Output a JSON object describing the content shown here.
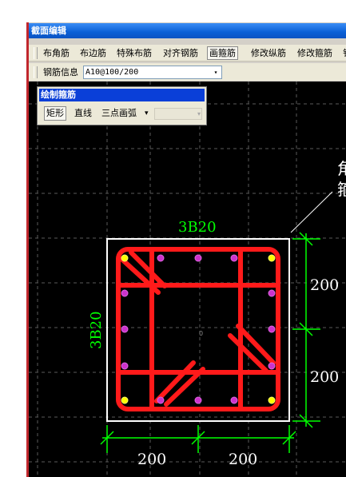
{
  "window": {
    "title": "截面编辑"
  },
  "toolbar": {
    "items": [
      {
        "label": "布角筋"
      },
      {
        "label": "布边筋"
      },
      {
        "label": "特殊布筋"
      },
      {
        "label": "对齐钢筋"
      },
      {
        "label": "画箍筋"
      },
      {
        "label": "修改纵筋"
      },
      {
        "label": "修改箍筋"
      },
      {
        "label": "钅"
      }
    ],
    "active_item": "画箍筋"
  },
  "rebar_info": {
    "label": "钢筋信息",
    "value": "A10@100/200",
    "arrow": "▾"
  },
  "draw_panel": {
    "title": "绘制箍筋",
    "buttons": [
      {
        "label": "矩形"
      },
      {
        "label": "直线"
      },
      {
        "label": "三点画弧"
      }
    ],
    "dropdown_arrow": "▾",
    "selected": "矩形"
  },
  "drawing": {
    "top_rebar_label": "3B20",
    "left_rebar_label": "3B20",
    "dimensions_right": [
      "200",
      "200"
    ],
    "dimensions_bottom": [
      "200",
      "200"
    ],
    "annotation_text": [
      "角",
      "箍"
    ],
    "origin_marker": "0",
    "colors": {
      "background": "#000000",
      "stirrup": "#ff1a1a",
      "dimension": "#00ff00",
      "label": "#00ff00",
      "outline": "#ffffff",
      "grid": "#5a5a5a",
      "corner_bar": "#ffff00",
      "side_bar": "#cc33cc"
    }
  }
}
